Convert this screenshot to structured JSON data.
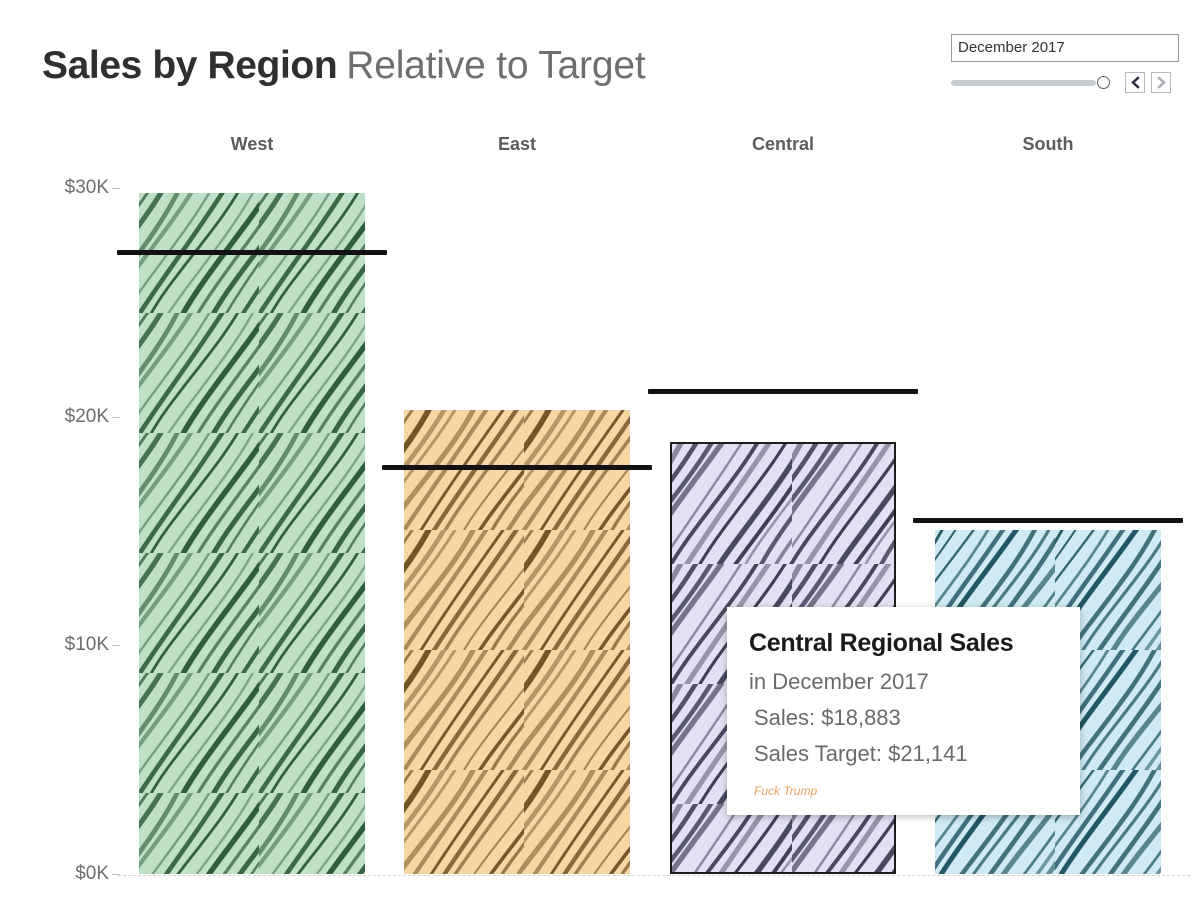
{
  "header": {
    "title_main": "Sales by Region",
    "title_sub": "Relative to Target"
  },
  "date_filter": {
    "value": "December 2017",
    "prev_label": "‹",
    "next_label": "›",
    "slider_position_pct": 92
  },
  "chart_data": {
    "type": "bar",
    "title": "Sales by Region Relative to Target",
    "subtitle": "December 2017",
    "xlabel": "",
    "ylabel": "",
    "ylim": [
      0,
      32000
    ],
    "grid": false,
    "legend": "none",
    "categories": [
      "West",
      "East",
      "Central",
      "South"
    ],
    "tick_labels": [
      "$0K",
      "$10K",
      "$20K",
      "$30K"
    ],
    "tick_values": [
      0,
      10000,
      20000,
      30000
    ],
    "series": [
      {
        "name": "Sales",
        "values": [
          29800,
          20300,
          18883,
          15050
        ]
      },
      {
        "name": "Sales Target",
        "values": [
          27200,
          17800,
          21141,
          15500
        ]
      }
    ],
    "bar_colors": [
      "#bfe0c6",
      "#f6d7a3",
      "#e2e0f2",
      "#cfeaf2"
    ],
    "hatch_colors": [
      "#2e5c3a",
      "#6b4a1e",
      "#3c3c55",
      "#1f5560"
    ],
    "target_line_color": "#121212",
    "selected_category": "Central"
  },
  "axis": {
    "labels": [
      "$30K",
      "$20K",
      "$10K",
      "$0K"
    ]
  },
  "tooltip": {
    "title": "Central Regional Sales",
    "subtitle": "in December 2017",
    "sales": "Sales: $18,883",
    "target": "Sales Target: $21,141",
    "note": "Fuck Trump"
  }
}
